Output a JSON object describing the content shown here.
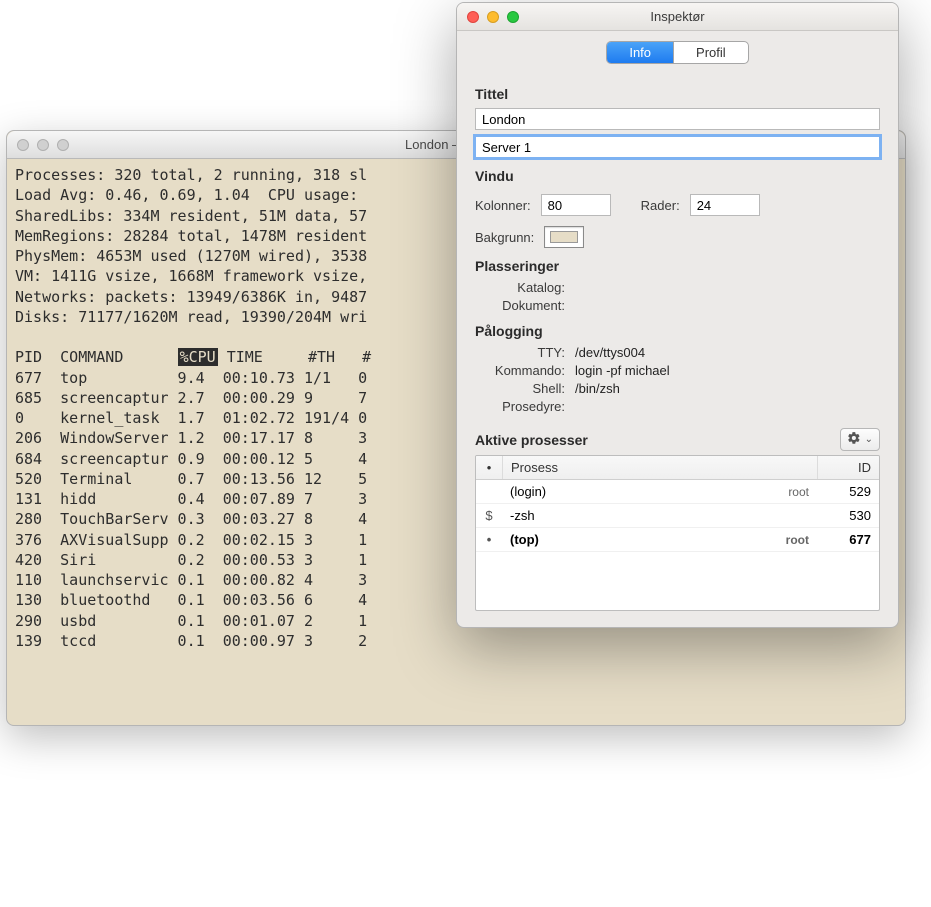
{
  "terminal": {
    "title": "London — Server",
    "summary": [
      "Processes: 320 total, 2 running, 318 sl",
      "Load Avg: 0.46, 0.69, 1.04  CPU usage:",
      "SharedLibs: 334M resident, 51M data, 57",
      "MemRegions: 28284 total, 1478M resident",
      "PhysMem: 4653M used (1270M wired), 3538",
      "VM: 1411G vsize, 1668M framework vsize,",
      "Networks: packets: 13949/6386K in, 9487",
      "Disks: 71177/1620M read, 19390/204M wri"
    ],
    "headers": {
      "pid": "PID",
      "cmd": "COMMAND",
      "cpu": "%CPU",
      "time": "TIME",
      "th": "#TH",
      "extra": "#"
    },
    "rows": [
      {
        "pid": "677",
        "cmd": "top",
        "cpu": "9.4",
        "time": "00:10.73",
        "th": "1/1",
        "x": "0"
      },
      {
        "pid": "685",
        "cmd": "screencaptur",
        "cpu": "2.7",
        "time": "00:00.29",
        "th": "9",
        "x": "7"
      },
      {
        "pid": "0",
        "cmd": "kernel_task",
        "cpu": "1.7",
        "time": "01:02.72",
        "th": "191/4",
        "x": "0"
      },
      {
        "pid": "206",
        "cmd": "WindowServer",
        "cpu": "1.2",
        "time": "00:17.17",
        "th": "8",
        "x": "3"
      },
      {
        "pid": "684",
        "cmd": "screencaptur",
        "cpu": "0.9",
        "time": "00:00.12",
        "th": "5",
        "x": "4"
      },
      {
        "pid": "520",
        "cmd": "Terminal",
        "cpu": "0.7",
        "time": "00:13.56",
        "th": "12",
        "x": "5"
      },
      {
        "pid": "131",
        "cmd": "hidd",
        "cpu": "0.4",
        "time": "00:07.89",
        "th": "7",
        "x": "3"
      },
      {
        "pid": "280",
        "cmd": "TouchBarServ",
        "cpu": "0.3",
        "time": "00:03.27",
        "th": "8",
        "x": "4"
      },
      {
        "pid": "376",
        "cmd": "AXVisualSupp",
        "cpu": "0.2",
        "time": "00:02.15",
        "th": "3",
        "x": "1"
      },
      {
        "pid": "420",
        "cmd": "Siri",
        "cpu": "0.2",
        "time": "00:00.53",
        "th": "3",
        "x": "1"
      },
      {
        "pid": "110",
        "cmd": "launchservic",
        "cpu": "0.1",
        "time": "00:00.82",
        "th": "4",
        "x": "3"
      },
      {
        "pid": "130",
        "cmd": "bluetoothd",
        "cpu": "0.1",
        "time": "00:03.56",
        "th": "6",
        "x": "4"
      },
      {
        "pid": "290",
        "cmd": "usbd",
        "cpu": "0.1",
        "time": "00:01.07",
        "th": "2",
        "x": "1"
      },
      {
        "pid": "139",
        "cmd": "tccd",
        "cpu": "0.1",
        "time": "00:00.97",
        "th": "3",
        "x": "2"
      }
    ]
  },
  "inspector": {
    "title": "Inspektør",
    "tabs": {
      "info": "Info",
      "profil": "Profil"
    },
    "sections": {
      "tittel": "Tittel",
      "vindu": "Vindu",
      "plasseringer": "Plasseringer",
      "palogging": "Pålogging",
      "aktive": "Aktive prosesser"
    },
    "title_field1": "London",
    "title_field2": "Server 1",
    "vindu": {
      "kolonner_label": "Kolonner:",
      "kolonner": "80",
      "rader_label": "Rader:",
      "rader": "24",
      "bakgrunn_label": "Bakgrunn:",
      "bg_color": "#e6ddc7"
    },
    "plasseringer": {
      "katalog_label": "Katalog:",
      "katalog": "",
      "dokument_label": "Dokument:",
      "dokument": ""
    },
    "palogging": {
      "tty_label": "TTY:",
      "tty": "/dev/ttys004",
      "kommando_label": "Kommando:",
      "kommando": "login -pf michael",
      "shell_label": "Shell:",
      "shell": "/bin/zsh",
      "prosedyre_label": "Prosedyre:",
      "prosedyre": ""
    },
    "proc_table": {
      "col_proc": "Prosess",
      "col_id": "ID",
      "rows": [
        {
          "ico": "",
          "name": "(login)",
          "user": "root",
          "id": "529",
          "bold": false
        },
        {
          "ico": "$",
          "name": "-zsh",
          "user": "",
          "id": "530",
          "bold": false
        },
        {
          "ico": "•",
          "name": "(top)",
          "user": "root",
          "id": "677",
          "bold": true
        }
      ]
    }
  }
}
